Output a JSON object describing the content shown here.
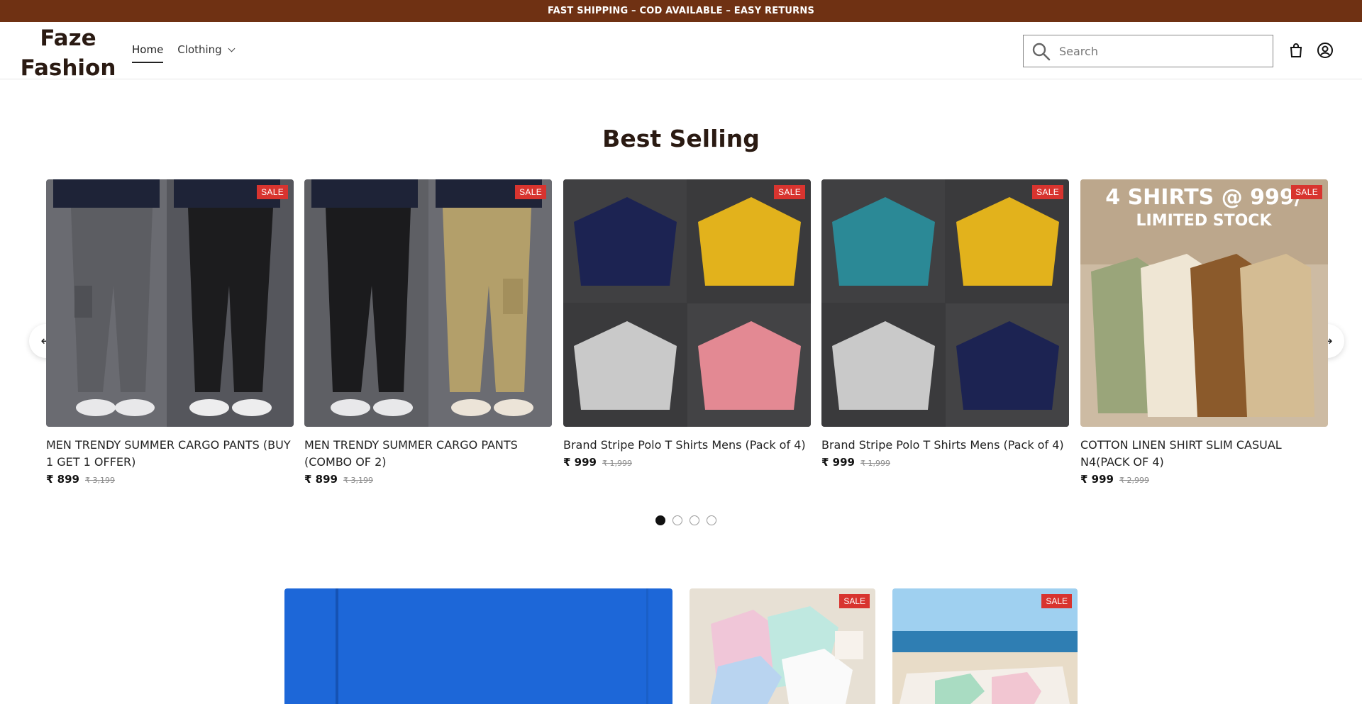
{
  "announcement": "FAST SHIPPING – COD AVAILABLE – EASY RETURNS",
  "header": {
    "logo_line1": "Faze",
    "logo_line2": "Fashion",
    "nav": [
      {
        "label": "Home"
      },
      {
        "label": "Clothing"
      }
    ],
    "search_placeholder": "Search"
  },
  "section": {
    "title": "Best Selling",
    "products": [
      {
        "title": "MEN TRENDY SUMMER CARGO PANTS (BUY 1 GET 1 OFFER)",
        "price": "₹ 899",
        "compare": "₹ 3,199",
        "badge": "SALE"
      },
      {
        "title": "MEN TRENDY SUMMER CARGO PANTS (COMBO OF 2)",
        "price": "₹ 899",
        "compare": "₹ 3,199",
        "badge": "SALE"
      },
      {
        "title": "Brand Stripe Polo T Shirts Mens (Pack of 4)",
        "price": "₹ 999",
        "compare": "₹ 1,999",
        "badge": "SALE"
      },
      {
        "title": "Brand Stripe Polo T Shirts Mens (Pack of 4)",
        "price": "₹ 999",
        "compare": "₹ 1,999",
        "badge": "SALE"
      },
      {
        "title": "COTTON LINEN SHIRT SLIM CASUAL N4(PACK OF 4)",
        "price": "₹ 999",
        "compare": "₹ 2,999",
        "badge": "SALE",
        "image_text_1": "4 SHIRTS @ 999/",
        "image_text_2": "LIMITED STOCK"
      }
    ],
    "prev_icon": "arrow-left-icon",
    "next_icon": "arrow-right-icon",
    "pagination": {
      "total": 4,
      "active": 1
    }
  },
  "promos": [
    {
      "badge": ""
    },
    {
      "badge": "SALE"
    },
    {
      "badge": "SALE"
    }
  ],
  "colors": {
    "announcement_bg": "#6f3113",
    "sale_badge": "#d8342f",
    "title_brown": "#2a1a12"
  }
}
